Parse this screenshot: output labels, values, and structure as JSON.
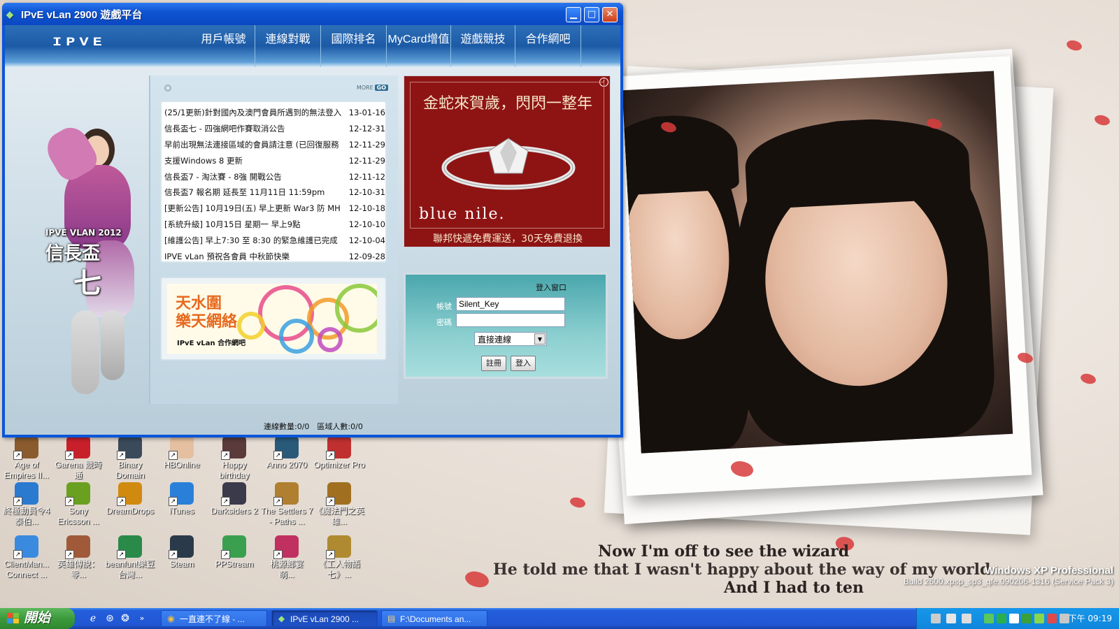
{
  "window": {
    "title": "IPvE vLan 2900 遊戲平台",
    "logo": "IPVE",
    "nav": [
      "用戶帳號",
      "連線對戰",
      "國際排名",
      "MyCard增值",
      "遊戲競技",
      "合作網吧"
    ]
  },
  "hero": {
    "line1": "IPVE VLAN 2012",
    "line2": "信長盃",
    "line3": "七"
  },
  "news": {
    "more_label": "MORE",
    "go_label": "GO",
    "items": [
      {
        "title": "(25/1更新)針對國內及澳門會員所遇到的無法登入",
        "date": "13-01-16"
      },
      {
        "title": "信長盃七 - 四強網吧作賽取消公告",
        "date": "12-12-31"
      },
      {
        "title": "早前出現無法連接區域的會員請注意 (已回復服務",
        "date": "12-11-29"
      },
      {
        "title": "支援Windows 8 更新",
        "date": "12-11-29"
      },
      {
        "title": "信長盃7 - 淘汰賽 - 8強 開戰公告",
        "date": "12-11-12"
      },
      {
        "title": "信長盃7 報名期 延長至 11月11日 11:59pm",
        "date": "12-10-31"
      },
      {
        "title": "[更新公告] 10月19日(五) 早上更新 War3 防 MH",
        "date": "12-10-18"
      },
      {
        "title": "[系統升級] 10月15日 星期一 早上9點",
        "date": "12-10-10"
      },
      {
        "title": "[維護公告] 早上7:30 至 8:30 的緊急維護已完成",
        "date": "12-10-04"
      },
      {
        "title": "IPVE vLan 預祝各會員 中秋節快樂",
        "date": "12-09-28"
      }
    ]
  },
  "partner_banner": {
    "line1": "天水圍",
    "line2": "樂天網絡",
    "tagline": "IPvE vLan 合作網吧"
  },
  "ad": {
    "headline": "金蛇來賀歲，閃閃一整年",
    "brand": "blue nile.",
    "footer": "聯邦快遞免費運送，30天免費退換",
    "info_icon": "info-icon"
  },
  "login": {
    "title": "登入窗口",
    "account_label": "帳號",
    "account_value": "Silent_Key",
    "password_label": "密碼",
    "password_value": "",
    "connection_selected": "直接連線",
    "register_label": "註冊",
    "login_label": "登入"
  },
  "status": {
    "text": "連線數量:0/0　區域人數:0/0"
  },
  "desktop_icons": [
    {
      "label": "Age of Empires II...",
      "icon": "age-of-empires-icon",
      "color": "#8a5b2e"
    },
    {
      "label": "Garena 競時通",
      "icon": "garena-icon",
      "color": "#c8202a"
    },
    {
      "label": "Binary Domain",
      "icon": "binary-domain-icon",
      "color": "#3a4a5a"
    },
    {
      "label": "HBOnline",
      "icon": "hbonline-icon",
      "color": "#e4c0a0"
    },
    {
      "label": "Happy birthday",
      "icon": "happy-birthday-icon",
      "color": "#5a3a3a"
    },
    {
      "label": "Anno 2070",
      "icon": "anno-2070-icon",
      "color": "#2a5a7a"
    },
    {
      "label": "Optimizer Pro",
      "icon": "optimizer-pro-icon",
      "color": "#c03030"
    },
    {
      "label": "終極動員令4 泰伯...",
      "icon": "command-conquer-icon",
      "color": "#2a7ad0"
    },
    {
      "label": "Sony Ericsson ...",
      "icon": "sony-ericsson-icon",
      "color": "#6aa020"
    },
    {
      "label": "DreamDrops",
      "icon": "dreamdrops-icon",
      "color": "#d08a10"
    },
    {
      "label": "iTunes",
      "icon": "itunes-icon",
      "color": "#2a80d8"
    },
    {
      "label": "Darksiders 2",
      "icon": "darksiders-icon",
      "color": "#3a3a4a"
    },
    {
      "label": "The Settlers 7 - Paths ...",
      "icon": "settlers-icon",
      "color": "#b08030"
    },
    {
      "label": "《魔法門之英雄...",
      "icon": "heroes-icon",
      "color": "#a07020"
    },
    {
      "label": "ClientMan... Connect ...",
      "icon": "clientman-icon",
      "color": "#3a8ae0"
    },
    {
      "label": "英雄傳說：零...",
      "icon": "legend-heroes-icon",
      "color": "#a05a3a"
    },
    {
      "label": "beanfun!樂豆台灣...",
      "icon": "beanfun-icon",
      "color": "#2a8a4a"
    },
    {
      "label": "Steam",
      "icon": "steam-icon",
      "color": "#2a3a4a"
    },
    {
      "label": "PPStream",
      "icon": "ppstream-icon",
      "color": "#3aa050"
    },
    {
      "label": "桃源鄉宴　萌...",
      "icon": "taoyuan-icon",
      "color": "#c03060"
    },
    {
      "label": "《工人物語七》...",
      "icon": "settlers-7-icon",
      "color": "#b08a30"
    }
  ],
  "wallpaper": {
    "lyric1": "Now I'm off to see the wizard",
    "lyric2": "He told me that I wasn't happy about the way of my world",
    "lyric3": "And I had to ten",
    "os_name": "Windows XP Professional",
    "build": "Build 2600.xpsp_sp3_qfe.090206-1316 (Service Pack 3)"
  },
  "taskbar": {
    "start_label": "開始",
    "tasks": [
      {
        "label": "一直連不了線 - ...",
        "icon": "chrome-icon",
        "active": false
      },
      {
        "label": "IPvE vLan 2900 ...",
        "icon": "ipve-icon",
        "active": true
      },
      {
        "label": "F:\\Documents an...",
        "icon": "folder-icon",
        "active": false
      }
    ],
    "clock": "下午 09:19"
  },
  "colors": {
    "xp_blue": "#0b55d8",
    "start_green": "#3c9a3c",
    "ad_red": "#8e1414",
    "login_teal": "#4aa7ad"
  }
}
